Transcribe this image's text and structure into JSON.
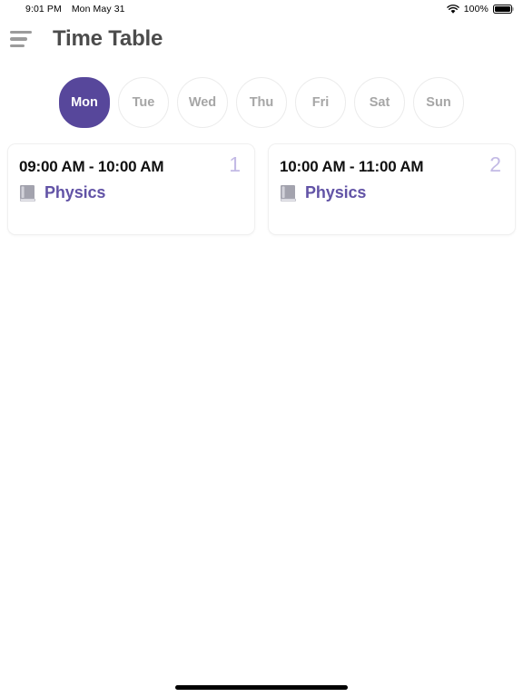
{
  "status_bar": {
    "time": "9:01 PM",
    "date": "Mon May 31",
    "battery_percent": "100%",
    "wifi_icon": "wifi-icon",
    "battery_icon": "battery-full-icon"
  },
  "app_bar": {
    "menu_icon": "hamburger-menu-icon",
    "title": "Time Table"
  },
  "day_selector": {
    "days": [
      {
        "label": "Mon",
        "selected": true
      },
      {
        "label": "Tue",
        "selected": false
      },
      {
        "label": "Wed",
        "selected": false
      },
      {
        "label": "Thu",
        "selected": false
      },
      {
        "label": "Fri",
        "selected": false
      },
      {
        "label": "Sat",
        "selected": false
      },
      {
        "label": "Sun",
        "selected": false
      }
    ],
    "selected_color": "#57479b",
    "unselected_text_color": "#a6a6a6",
    "unselected_border_color": "#ebebeb"
  },
  "classes": [
    {
      "time": "09:00 AM - 10:00 AM",
      "subject": "Physics",
      "index": "1",
      "subject_icon": "book-icon"
    },
    {
      "time": "10:00 AM - 11:00 AM",
      "subject": "Physics",
      "index": "2",
      "subject_icon": "book-icon"
    }
  ],
  "theme": {
    "accent": "#57479b",
    "subject_text": "#6253a6",
    "index_badge": "#c3bae5",
    "title_text": "#4c4c4c",
    "card_border": "#f0f0f0"
  },
  "home_indicator": "home-indicator"
}
